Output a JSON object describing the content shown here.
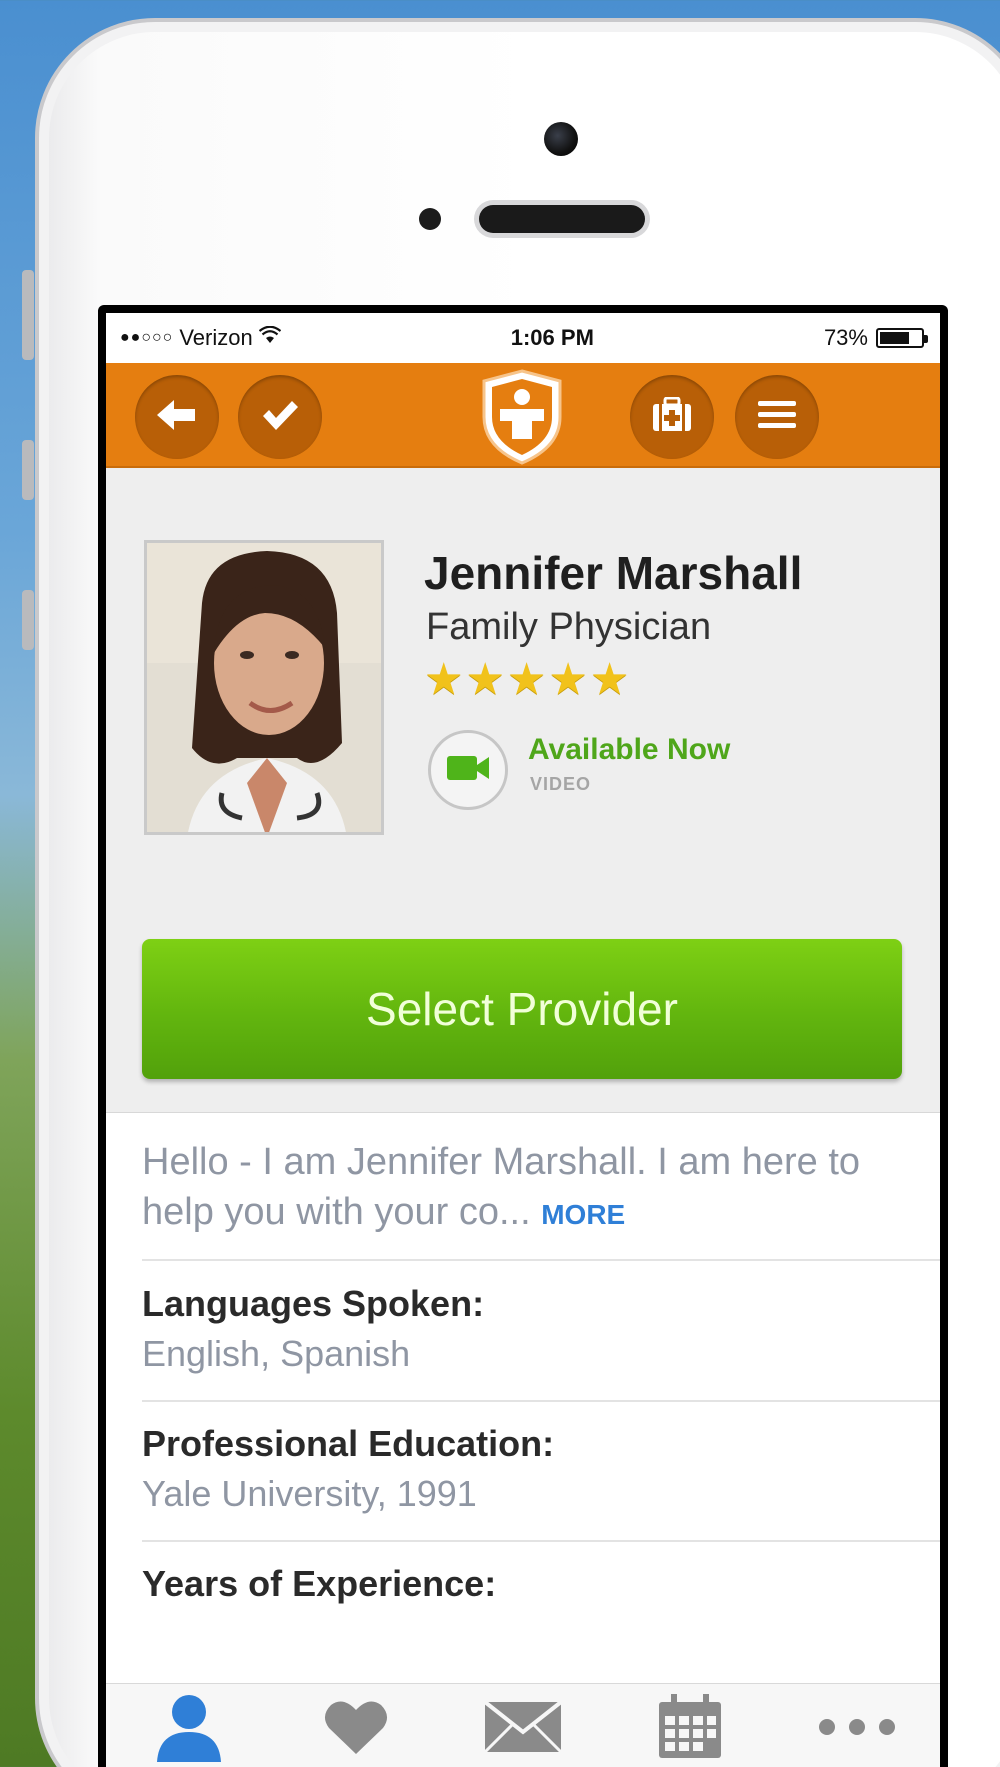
{
  "status_bar": {
    "carrier": "Verizon",
    "signal_dots": "●●○○○",
    "time": "1:06 PM",
    "battery_percent": "73%",
    "battery_level": 0.73
  },
  "nav_bar": {
    "color": "#e57e10",
    "buttons": [
      {
        "name": "back",
        "icon": "arrow-left-icon"
      },
      {
        "name": "check",
        "icon": "checkmark-icon"
      },
      {
        "name": "medical-kit",
        "icon": "medical-kit-icon"
      },
      {
        "name": "menu",
        "icon": "hamburger-menu-icon"
      }
    ],
    "logo_icon": "shield-person-logo"
  },
  "provider": {
    "name": "Jennifer Marshall",
    "title": "Family Physician",
    "rating": 5,
    "rating_max": 5,
    "availability": "Available Now",
    "availability_type": "VIDEO",
    "availability_color": "#4fa61a"
  },
  "select_button": {
    "label": "Select Provider",
    "color": "#62b50e"
  },
  "bio": {
    "text": "Hello - I am Jennifer Marshall. I am here to help you with your co...",
    "more_label": "MORE"
  },
  "details": [
    {
      "label": "Languages Spoken:",
      "value": "English, Spanish"
    },
    {
      "label": "Professional Education:",
      "value": "Yale University, 1991"
    },
    {
      "label": "Years of Experience:",
      "value": ""
    }
  ],
  "tab_bar": {
    "tabs": [
      {
        "name": "profile",
        "icon": "person-icon",
        "active": true
      },
      {
        "name": "favorites",
        "icon": "heart-icon",
        "active": false
      },
      {
        "name": "messages",
        "icon": "envelope-icon",
        "active": false
      },
      {
        "name": "calendar",
        "icon": "calendar-icon",
        "active": false
      },
      {
        "name": "more",
        "icon": "more-dots-icon",
        "active": false
      }
    ],
    "active_color": "#2f7fd7",
    "inactive_color": "#8a8a8a"
  }
}
